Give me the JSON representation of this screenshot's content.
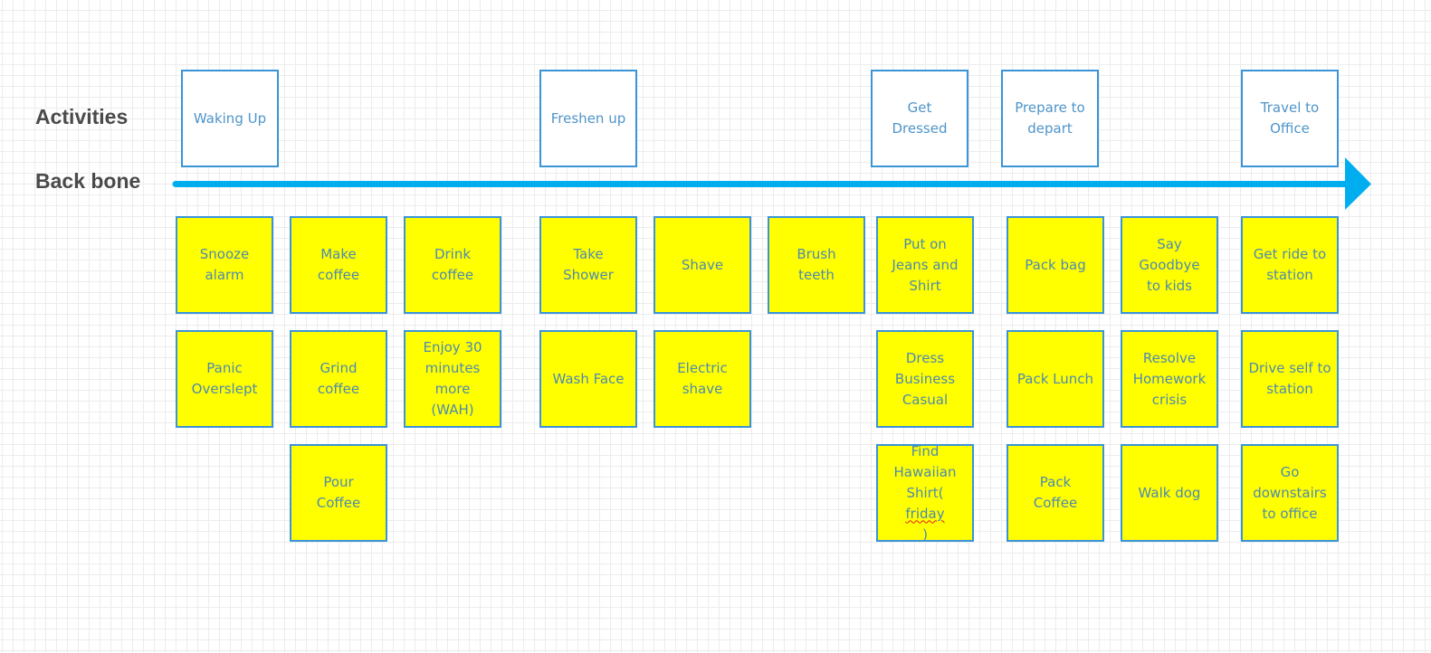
{
  "labels": {
    "activities": "Activities",
    "backbone": "Back bone"
  },
  "colors": {
    "backbone_arrow": "#00aeef",
    "box_border": "#3a94d6",
    "task_fill": "#ffff00",
    "activity_fill": "#ffffff",
    "label_text": "#4a4a4a"
  },
  "activities": [
    {
      "id": "waking-up",
      "text": "Waking Up"
    },
    {
      "id": "freshen-up",
      "text": "Freshen up"
    },
    {
      "id": "get-dressed",
      "text": "Get Dressed"
    },
    {
      "id": "prepare-to-depart",
      "text": "Prepare to depart"
    },
    {
      "id": "travel-to-office",
      "text": "Travel to Office"
    }
  ],
  "task_columns": [
    {
      "activity": "waking-up",
      "tasks": [
        "Snooze alarm",
        "Panic Overslept"
      ]
    },
    {
      "activity": "waking-up",
      "tasks": [
        "Make coffee",
        "Grind coffee",
        "Pour Coffee"
      ]
    },
    {
      "activity": "waking-up",
      "tasks": [
        "Drink coffee",
        "Enjoy 30 minutes more (WAH)"
      ]
    },
    {
      "activity": "freshen-up",
      "tasks": [
        "Take Shower",
        "Wash Face"
      ]
    },
    {
      "activity": "freshen-up",
      "tasks": [
        "Shave",
        "Electric shave"
      ]
    },
    {
      "activity": "freshen-up",
      "tasks": [
        "Brush teeth"
      ]
    },
    {
      "activity": "get-dressed",
      "tasks": [
        "Put on Jeans and Shirt",
        "Dress Business Casual",
        "Find Hawaiian Shirt(friday)"
      ]
    },
    {
      "activity": "prepare-to-depart",
      "tasks": [
        "Pack bag",
        "Pack Lunch",
        "Pack Coffee"
      ]
    },
    {
      "activity": "prepare-to-depart",
      "tasks": [
        "Say Goodbye to kids",
        "Resolve Homework crisis",
        "Walk dog"
      ]
    },
    {
      "activity": "travel-to-office",
      "tasks": [
        "Get ride to station",
        "Drive self to station",
        "Go downstairs to office"
      ]
    }
  ],
  "spellcheck_flagged": [
    "friday"
  ]
}
